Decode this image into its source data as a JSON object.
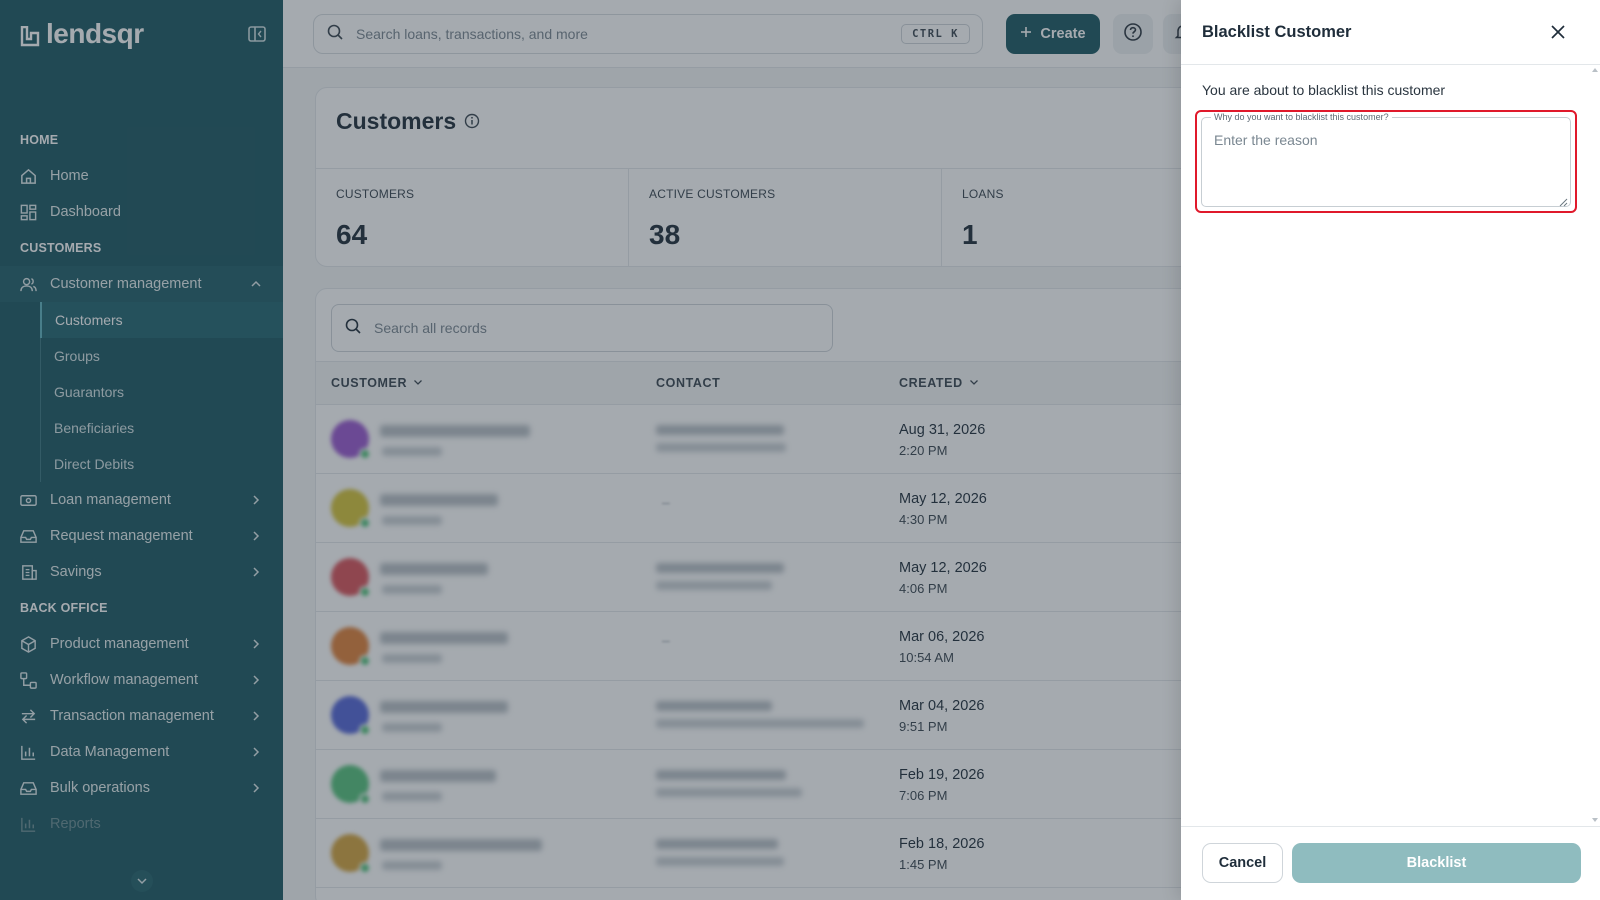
{
  "brand": {
    "name": "lendsqr"
  },
  "colors": {
    "sidebar": "#1d5862",
    "accent": "#1d5862",
    "highlight": "#e0192b",
    "blacklist_disabled": "#8fbcbf"
  },
  "sidebar": {
    "sections": [
      {
        "title": "HOME",
        "items": [
          {
            "label": "Home",
            "icon": "home-icon"
          },
          {
            "label": "Dashboard",
            "icon": "dashboard-icon"
          }
        ]
      },
      {
        "title": "CUSTOMERS",
        "items": [
          {
            "label": "Customer management",
            "icon": "users-icon",
            "expanded": true,
            "children": [
              "Customers",
              "Groups",
              "Guarantors",
              "Beneficiaries",
              "Direct Debits"
            ],
            "active_child": "Customers"
          },
          {
            "label": "Loan management",
            "icon": "money-icon"
          },
          {
            "label": "Request management",
            "icon": "inbox-icon"
          },
          {
            "label": "Savings",
            "icon": "building-icon"
          }
        ]
      },
      {
        "title": "BACK OFFICE",
        "items": [
          {
            "label": "Product management",
            "icon": "box-icon"
          },
          {
            "label": "Workflow management",
            "icon": "workflow-icon"
          },
          {
            "label": "Transaction management",
            "icon": "transfer-icon"
          },
          {
            "label": "Data Management",
            "icon": "bar-chart-icon"
          },
          {
            "label": "Bulk operations",
            "icon": "inbox-icon"
          },
          {
            "label": "Reports",
            "icon": "bar-chart-icon"
          }
        ]
      }
    ]
  },
  "topbar": {
    "search_placeholder": "Search loans, transactions, and more",
    "shortcut": "CTRL K",
    "create_label": "Create"
  },
  "customers_card": {
    "title": "Customers",
    "stats": [
      {
        "label": "CUSTOMERS",
        "value": "64"
      },
      {
        "label": "ACTIVE CUSTOMERS",
        "value": "38"
      },
      {
        "label": "LOANS",
        "value": "1"
      }
    ]
  },
  "table": {
    "search_placeholder": "Search all records",
    "columns": [
      "CUSTOMER",
      "CONTACT",
      "CREATED"
    ],
    "rows": [
      {
        "created_date": "Aug 31, 2026",
        "created_time": "2:20 PM",
        "avatar_color": "#9b59d0",
        "has_contact": true
      },
      {
        "created_date": "May 12, 2026",
        "created_time": "4:30 PM",
        "avatar_color": "#d6c43a",
        "has_contact": false
      },
      {
        "created_date": "May 12, 2026",
        "created_time": "4:06 PM",
        "avatar_color": "#d9545b",
        "has_contact": true
      },
      {
        "created_date": "Mar 06, 2026",
        "created_time": "10:54 AM",
        "avatar_color": "#e0813a",
        "has_contact": false
      },
      {
        "created_date": "Mar 04, 2026",
        "created_time": "9:51 PM",
        "avatar_color": "#5566d8",
        "has_contact": true
      },
      {
        "created_date": "Feb 19, 2026",
        "created_time": "7:06 PM",
        "avatar_color": "#56c27c",
        "has_contact": true
      },
      {
        "created_date": "Feb 18, 2026",
        "created_time": "1:45 PM",
        "avatar_color": "#d4a43e",
        "has_contact": true
      }
    ]
  },
  "drawer": {
    "title": "Blacklist Customer",
    "description": "You are about to blacklist this customer",
    "field_label": "Why do you want to blacklist this customer?",
    "field_placeholder": "Enter the reason",
    "field_value": "",
    "cancel_label": "Cancel",
    "submit_label": "Blacklist"
  }
}
